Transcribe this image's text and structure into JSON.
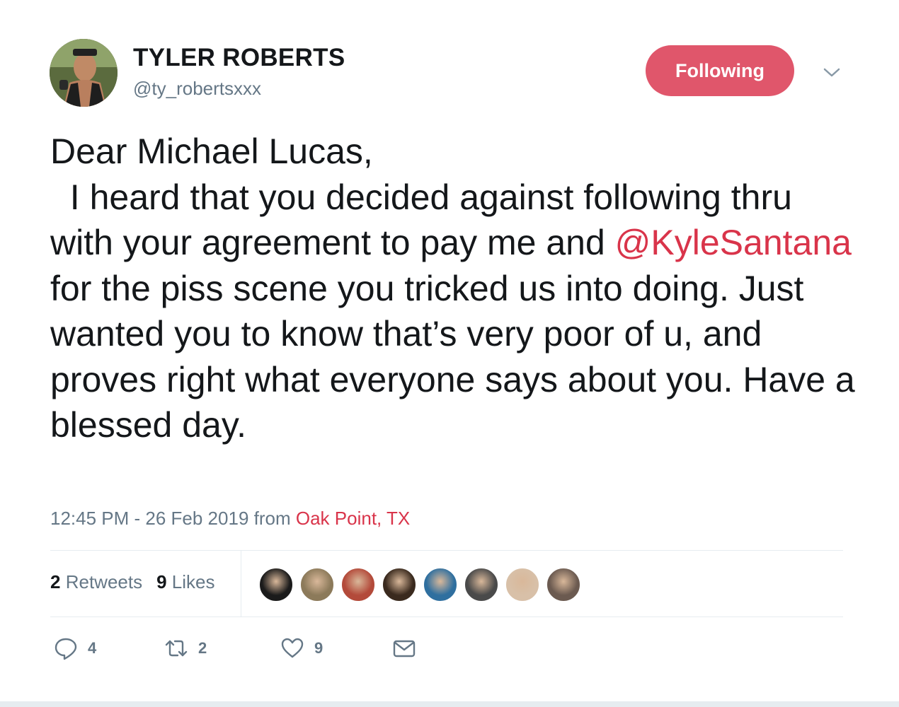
{
  "colors": {
    "accent": "#e0566b",
    "link": "#d9344a",
    "muted": "#657786",
    "text": "#14171a"
  },
  "author": {
    "name": "TYLER ROBERTS",
    "handle": "@ty_robertsxxx",
    "follow_label": "Following",
    "menu_icon": "chevron-down-icon"
  },
  "tweet": {
    "text_before": "Dear Michael Lucas,\n  I heard that you decided against following thru with your agreement to pay me and ",
    "mention": "@KyleSantana",
    "text_after": " for the piss scene you tricked us into doing. Just wanted you to know that’s very poor of u, and proves right what everyone says about you. Have a blessed day.",
    "time": "12:45 PM - 26 Feb 2019",
    "from_label": "from",
    "location": "Oak Point, TX"
  },
  "stats": {
    "retweets_count": "2",
    "retweets_label": "Retweets",
    "likes_count": "9",
    "likes_label": "Likes"
  },
  "likers": [
    {
      "icon": "avatar",
      "color": "#1b1b1b"
    },
    {
      "icon": "avatar",
      "color": "#8c7a5a"
    },
    {
      "icon": "avatar",
      "color": "#b34a3a"
    },
    {
      "icon": "avatar",
      "color": "#3a2a1e"
    },
    {
      "icon": "avatar",
      "color": "#2f6f9f"
    },
    {
      "icon": "avatar",
      "color": "#4a4a4a"
    },
    {
      "icon": "avatar",
      "color": "#d8c0a8"
    },
    {
      "icon": "avatar",
      "color": "#6b5a50"
    }
  ],
  "actions": {
    "reply_count": "4",
    "retweet_count": "2",
    "like_count": "9"
  }
}
